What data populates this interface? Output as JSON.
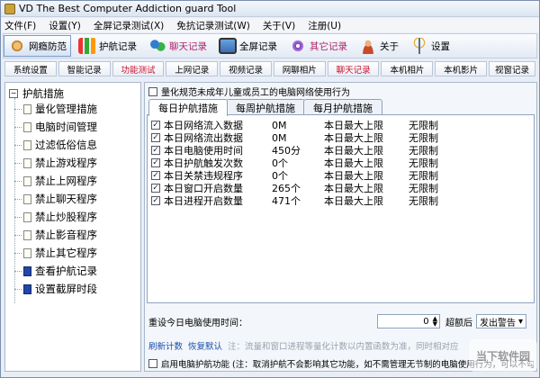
{
  "window": {
    "title": "VD The Best Computer Addiction guard Tool"
  },
  "menu": [
    "文件(F)",
    "设置(Y)",
    "全屏记录测试(X)",
    "免抗记录测试(W)",
    "关于(V)",
    "注册(U)"
  ],
  "toolbar": [
    {
      "label": "网瘾防范",
      "icon": "ship-wheel-icon",
      "color": "#c98a3a"
    },
    {
      "label": "护航记录",
      "icon": "bar-chart-icon",
      "color": "#3a9a3a"
    },
    {
      "label": "聊天记录",
      "icon": "people-icon",
      "color": "#2e7fd0"
    },
    {
      "label": "全屏记录",
      "icon": "monitor-icon",
      "color": "#3b6fb5"
    },
    {
      "label": "其它记录",
      "icon": "disc-icon",
      "color": "#7a3fb5"
    },
    {
      "label": "关于",
      "icon": "person-icon",
      "color": "#c84a2a"
    },
    {
      "label": "设置",
      "icon": "antenna-icon",
      "color": "#5a6f8a"
    }
  ],
  "subtabs": [
    "系统设置",
    "智能记录",
    "功能测试",
    "上网记录",
    "视频记录",
    "网聊相片",
    "聊天记录",
    "本机相片",
    "本机影片",
    "视窗记录"
  ],
  "tree": {
    "root": "护航措施",
    "items": [
      "量化管理措施",
      "电脑时间管理",
      "过滤低俗信息",
      "禁止游戏程序",
      "禁止上网程序",
      "禁止聊天程序",
      "禁止炒股程序",
      "禁止影音程序",
      "禁止其它程序",
      "查看护航记录",
      "设置截屏时段"
    ]
  },
  "main": {
    "top_check": "量化规范未成年儿童或员工的电脑网络使用行为",
    "tabs": [
      "每日护航措施",
      "每周护航措施",
      "每月护航措施"
    ],
    "rows": [
      {
        "name": "本日网络流入数据",
        "value": "0M",
        "limit_label": "本日最大上限",
        "limit": "无限制"
      },
      {
        "name": "本日网络流出数据",
        "value": "0M",
        "limit_label": "本日最大上限",
        "limit": "无限制"
      },
      {
        "name": "本日电脑使用时间",
        "value": "450分",
        "limit_label": "本日最大上限",
        "limit": "无限制"
      },
      {
        "name": "本日护航触发次数",
        "value": "0个",
        "limit_label": "本日最大上限",
        "limit": "无限制"
      },
      {
        "name": "本日关禁违规程序",
        "value": "0个",
        "limit_label": "本日最大上限",
        "limit": "无限制"
      },
      {
        "name": "本日窗口开启数量",
        "value": "265个",
        "limit_label": "本日最大上限",
        "limit": "无限制"
      },
      {
        "name": "本日进程开启数量",
        "value": "471个",
        "limit_label": "本日最大上限",
        "limit": "无限制"
      }
    ],
    "reset_label": "重设今日电脑使用时间：",
    "reset_value": "0",
    "after_label": "超额后",
    "action_value": "发出警告",
    "link_refresh": "刷新计数",
    "link_restore": "恢复默认",
    "note": "注：流量和窗口进程等量化计数以内置函数为准，同时相对应",
    "bottom_text": "启用电脑护航功能 (注：取消护航不会影响其它功能，如不需管理无节制的电脑使用行为，可以不勾选此单选框)"
  },
  "watermark": "当下软件园"
}
